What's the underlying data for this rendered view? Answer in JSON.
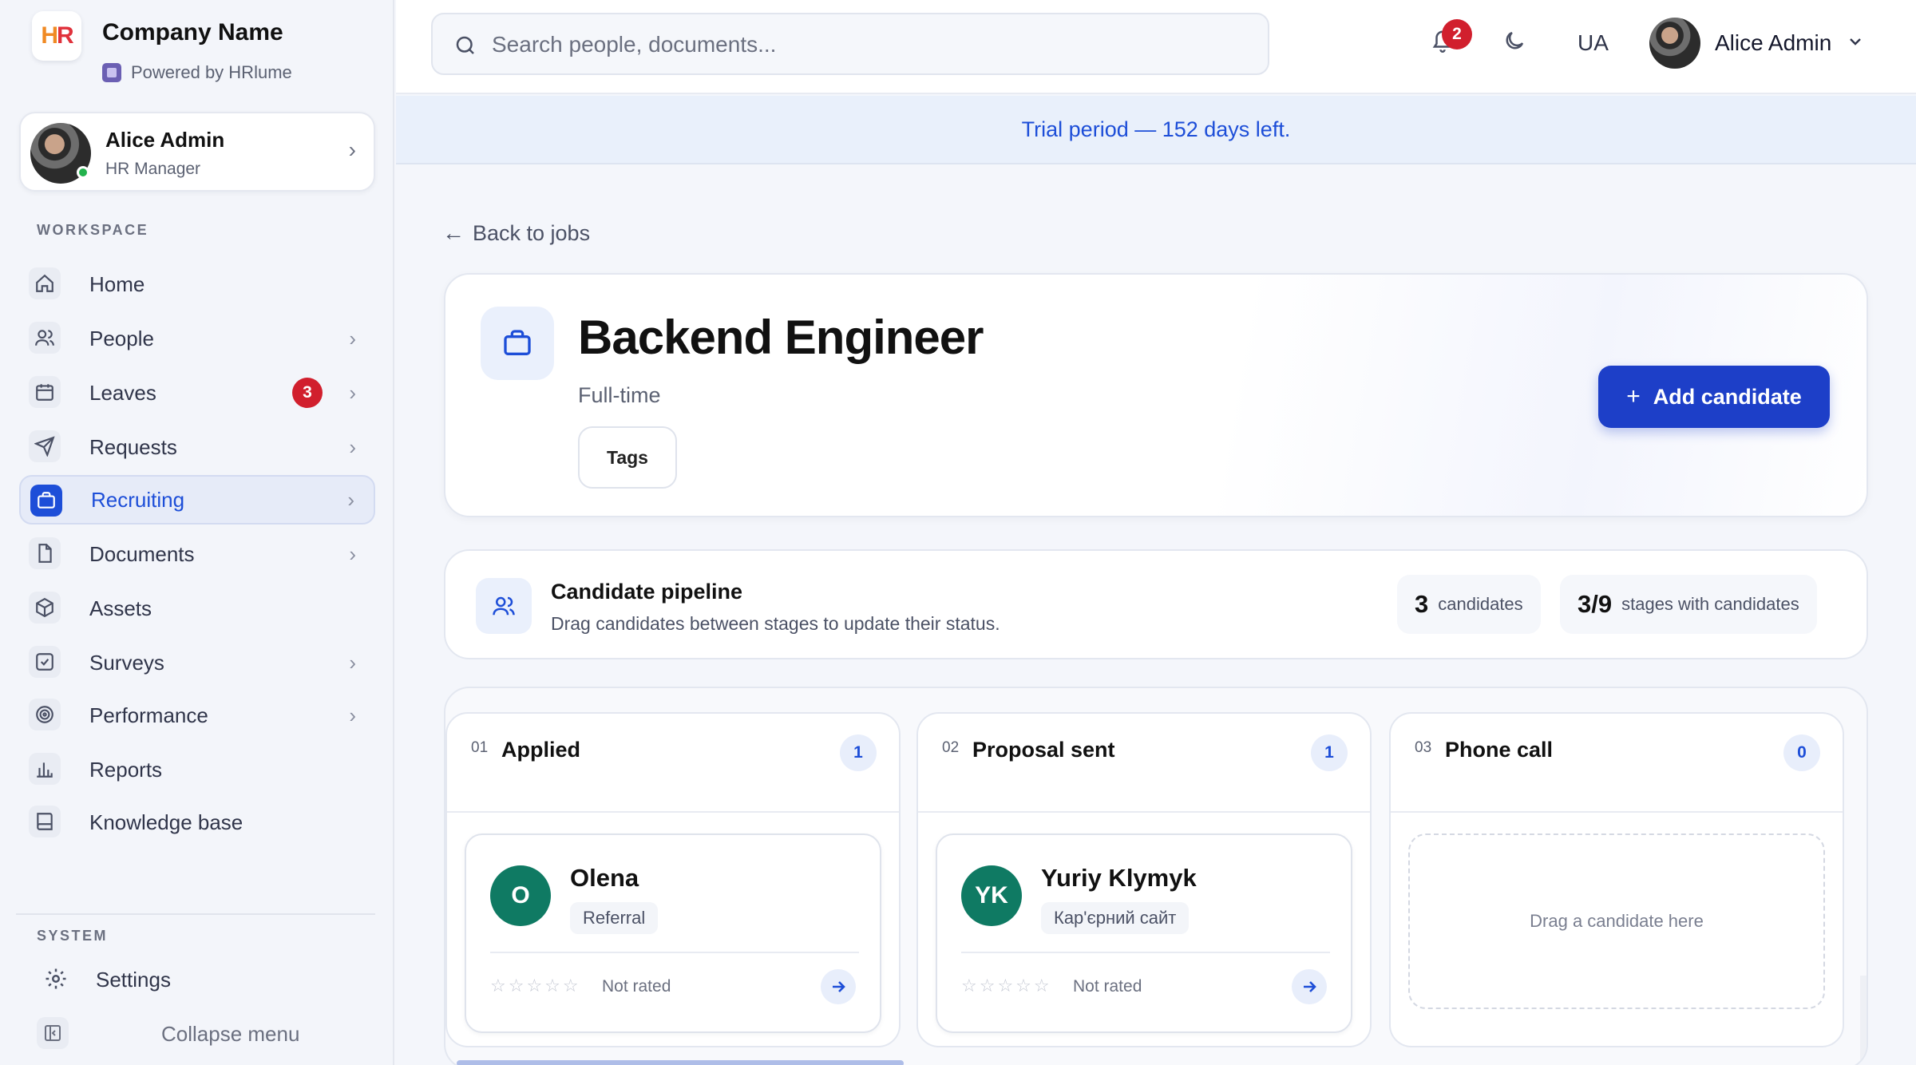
{
  "brand": {
    "name": "Company Name",
    "logo_text_h": "H",
    "logo_text_r": "R",
    "powered_by": "Powered by HRlume"
  },
  "user": {
    "name": "Alice Admin",
    "role": "HR Manager"
  },
  "sidebar": {
    "workspace_label": "WORKSPACE",
    "system_label": "SYSTEM",
    "items": [
      {
        "label": "Home",
        "icon": "home-icon",
        "chevron": false
      },
      {
        "label": "People",
        "icon": "people-icon",
        "chevron": true
      },
      {
        "label": "Leaves",
        "icon": "calendar-icon",
        "chevron": true,
        "badge": "3"
      },
      {
        "label": "Requests",
        "icon": "send-icon",
        "chevron": true
      },
      {
        "label": "Recruiting",
        "icon": "briefcase-icon",
        "chevron": true,
        "active": true
      },
      {
        "label": "Documents",
        "icon": "document-icon",
        "chevron": true
      },
      {
        "label": "Assets",
        "icon": "box-icon",
        "chevron": false
      },
      {
        "label": "Surveys",
        "icon": "checkbox-icon",
        "chevron": true
      },
      {
        "label": "Performance",
        "icon": "target-icon",
        "chevron": true
      },
      {
        "label": "Reports",
        "icon": "bar-chart-icon",
        "chevron": false
      },
      {
        "label": "Knowledge base",
        "icon": "book-icon",
        "chevron": false
      }
    ],
    "settings_label": "Settings",
    "collapse_label": "Collapse menu"
  },
  "topbar": {
    "search_placeholder": "Search people, documents...",
    "notifications_count": "2",
    "language": "UA",
    "user_name": "Alice Admin"
  },
  "trial": {
    "text": "Trial period — 152 days left."
  },
  "back_link": "Back to jobs",
  "job": {
    "title": "Backend Engineer",
    "type": "Full-time",
    "tags_label": "Tags",
    "add_candidate_label": "Add candidate"
  },
  "pipeline": {
    "title": "Candidate pipeline",
    "subtitle": "Drag candidates between stages to update their status.",
    "candidates_count": "3",
    "candidates_label": "candidates",
    "stages_count": "3/9",
    "stages_label": "stages with candidates"
  },
  "stages": [
    {
      "num": "01",
      "title": "Applied",
      "count": "1"
    },
    {
      "num": "02",
      "title": "Proposal sent",
      "count": "1"
    },
    {
      "num": "03",
      "title": "Phone call",
      "count": "0"
    }
  ],
  "candidates": [
    {
      "initials": "O",
      "name": "Olena",
      "source": "Referral",
      "rating": 0,
      "rating_label": "Not rated"
    },
    {
      "initials": "YK",
      "name": "Yuriy Klymyk",
      "source": "Кар'єрний сайт",
      "rating": 0,
      "rating_label": "Not rated"
    }
  ],
  "dropzone_text": "Drag a candidate here",
  "colors": {
    "accent": "#1d4ed8",
    "primary_button": "#1d3fc8",
    "badge_red": "#d11f2d",
    "candidate_avatar": "#0f7a63",
    "trial_bg": "#e9f0fb"
  }
}
